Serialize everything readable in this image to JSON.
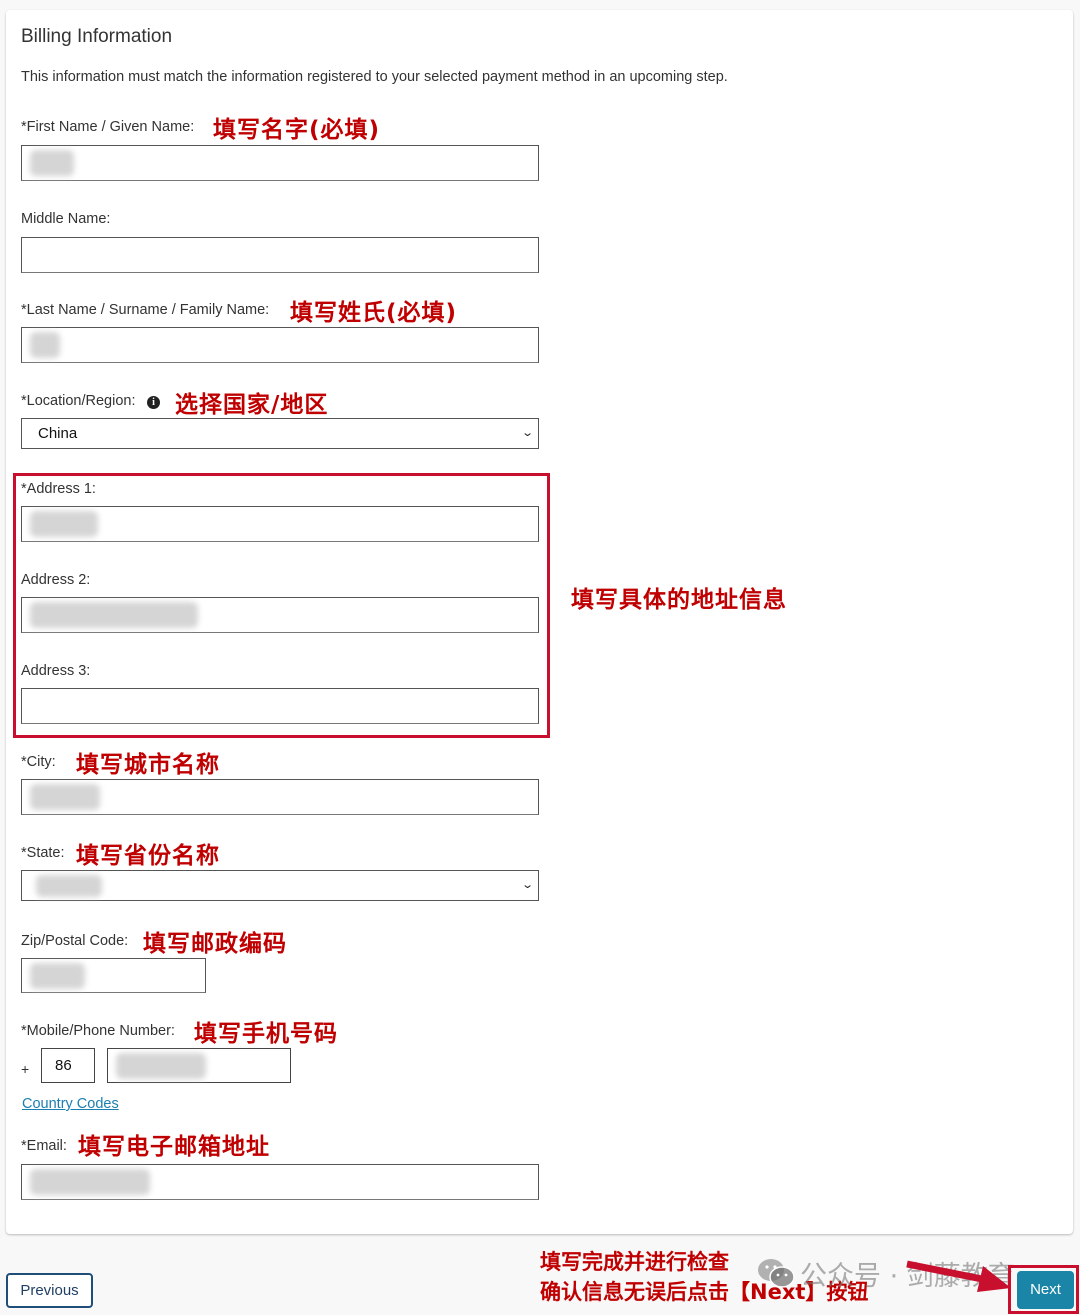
{
  "form": {
    "title": "Billing Information",
    "subtitle": "This information must match the information registered to your selected payment method in an upcoming step.",
    "fields": {
      "first_name": {
        "label": "*First Name / Given Name:",
        "annotation": "填写名字(必填)",
        "value": "[blurred]"
      },
      "middle_name": {
        "label": "Middle Name:",
        "value": ""
      },
      "last_name": {
        "label": "*Last Name / Surname / Family Name:",
        "annotation": "填写姓氏(必填)",
        "value": "[blurred]"
      },
      "location": {
        "label": "*Location/Region:",
        "info_icon": "info-icon",
        "annotation": "选择国家/地区",
        "value": "China"
      },
      "address1": {
        "label": "*Address 1:",
        "value": "[blurred]"
      },
      "address2": {
        "label": "Address 2:",
        "value": "[blurred]"
      },
      "address3": {
        "label": "Address 3:",
        "value": ""
      },
      "address_annotation": "填写具体的地址信息",
      "city": {
        "label": "*City:",
        "annotation": "填写城市名称",
        "value": "[blurred]"
      },
      "state": {
        "label": "*State:",
        "annotation": "填写省份名称",
        "value": "[blurred]"
      },
      "zip": {
        "label": "Zip/Postal Code:",
        "annotation": "填写邮政编码",
        "value": "[blurred]"
      },
      "phone": {
        "label": "*Mobile/Phone Number:",
        "annotation": "填写手机号码",
        "plus": "+",
        "country_code": "86",
        "value": "[blurred]"
      },
      "country_codes_link": "Country Codes",
      "email": {
        "label": "*Email:",
        "annotation": "填写电子邮箱地址",
        "value": "[blurred]"
      }
    }
  },
  "footer": {
    "previous_label": "Previous",
    "next_label": "Next",
    "annotation_line1": "填写完成并进行检查",
    "annotation_line2": "确认信息无误后点击【Next】按钮",
    "watermark": "公众号 · 剑藤教育"
  },
  "colors": {
    "annotation_red": "#c00000",
    "highlight_red": "#c8102e",
    "next_button": "#1a85a6",
    "link": "#1a7fb0",
    "previous_border": "#1f4e79"
  }
}
